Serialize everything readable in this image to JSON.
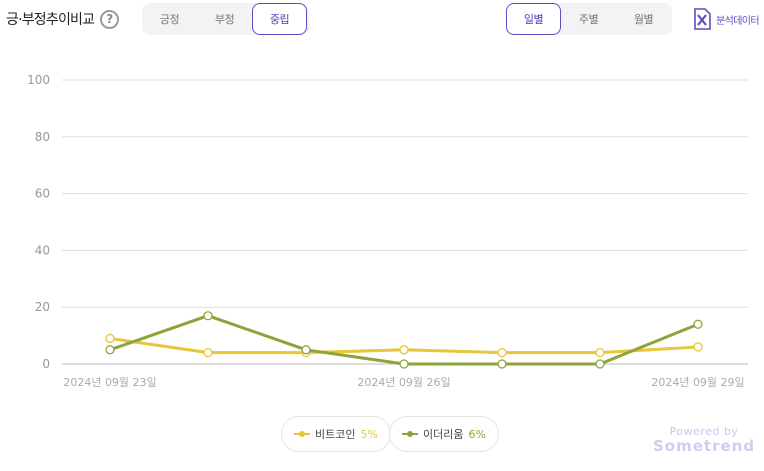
{
  "header": {
    "title": "긍·부정추이비교",
    "help_glyph": "?"
  },
  "sentiment_tabs": [
    {
      "label": "긍정",
      "active": false
    },
    {
      "label": "부정",
      "active": false
    },
    {
      "label": "중립",
      "active": true
    }
  ],
  "period_tabs": [
    {
      "label": "일별",
      "active": true
    },
    {
      "label": "주별",
      "active": false
    },
    {
      "label": "월별",
      "active": false
    }
  ],
  "export": {
    "label": "분석데이터",
    "icon": "excel-icon"
  },
  "legend": [
    {
      "name": "비트코인",
      "percent": "5%",
      "color": "#e8c53a"
    },
    {
      "name": "이더리움",
      "percent": "6%",
      "color": "#8fa33a"
    }
  ],
  "footer": {
    "powered_by": "Powered by",
    "brand": "Sometrend"
  },
  "colors": {
    "accent": "#5a4fc4",
    "grid": "#dddddd",
    "series_1": "#e8c53a",
    "series_2": "#8fa33a"
  },
  "chart_data": {
    "type": "line",
    "x": [
      "2024-09-23",
      "2024-09-24",
      "2024-09-25",
      "2024-09-26",
      "2024-09-27",
      "2024-09-28",
      "2024-09-29"
    ],
    "x_tick_labels": [
      {
        "index": 0,
        "label": "2024년 09월 23일"
      },
      {
        "index": 3,
        "label": "2024년 09월 26일"
      },
      {
        "index": 6,
        "label": "2024년 09월 29일"
      }
    ],
    "ylim": [
      0,
      100
    ],
    "yticks": [
      0,
      20,
      40,
      60,
      80,
      100
    ],
    "grid": true,
    "legend_position": "bottom-center",
    "series": [
      {
        "name": "비트코인",
        "color": "#e8c53a",
        "values": [
          9,
          4,
          4,
          5,
          4,
          4,
          6
        ]
      },
      {
        "name": "이더리움",
        "color": "#8fa33a",
        "values": [
          5,
          17,
          5,
          0,
          0,
          0,
          14
        ]
      }
    ]
  }
}
